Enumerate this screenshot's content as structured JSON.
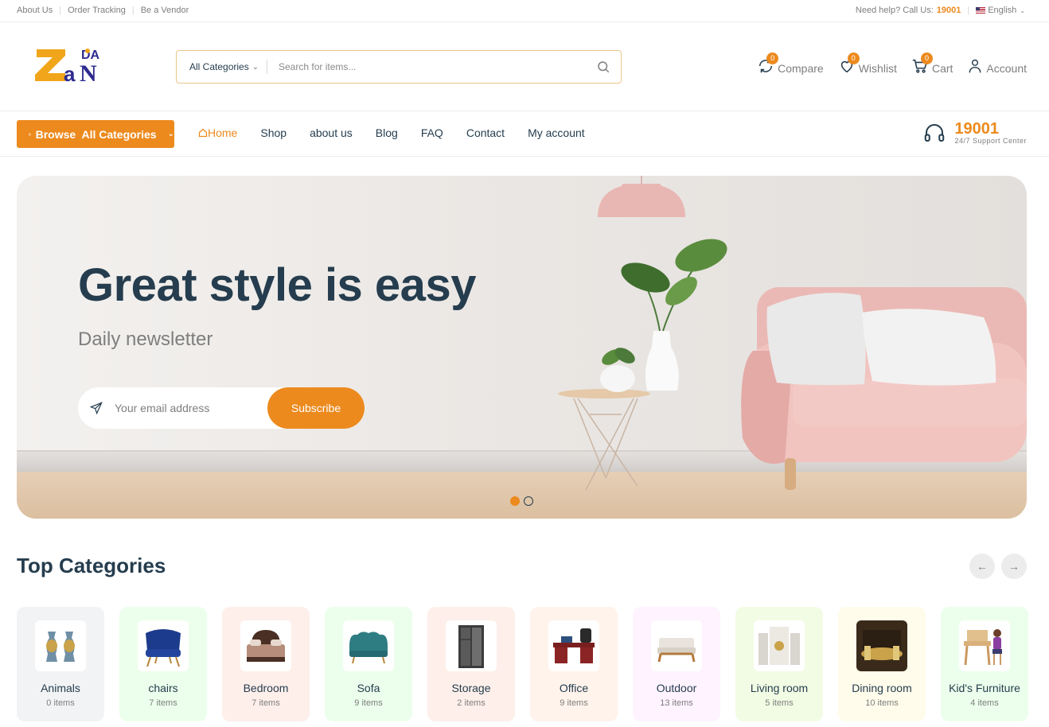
{
  "topbar": {
    "links": [
      "About Us",
      "Order Tracking",
      "Be a Vendor"
    ],
    "help_text": "Need help? Call Us:",
    "help_phone": "19001",
    "language": "English"
  },
  "header": {
    "search_category": "All Categories",
    "search_placeholder": "Search for items...",
    "actions": [
      {
        "label": "Compare",
        "count": "0",
        "icon": "compare-icon"
      },
      {
        "label": "Wishlist",
        "count": "0",
        "icon": "heart-icon"
      },
      {
        "label": "Cart",
        "count": "0",
        "icon": "cart-icon"
      },
      {
        "label": "Account",
        "icon": "user-icon"
      }
    ]
  },
  "nav": {
    "browse_label": "Browse  All Categories",
    "items": [
      "Home",
      "Shop",
      "about us",
      "Blog",
      "FAQ",
      "Contact",
      "My account"
    ],
    "active": "Home",
    "support_number": "19001",
    "support_label": "24/7 Support Center"
  },
  "hero": {
    "title": "Great style is easy",
    "subtitle": "Daily newsletter",
    "email_placeholder": "Your email address",
    "subscribe_label": "Subscribe",
    "slides": 2,
    "active_slide": 1
  },
  "categories": {
    "title": "Top Categories",
    "items": [
      {
        "name": "Animals",
        "count": "0 items",
        "bg": "#f2f3f4"
      },
      {
        "name": "chairs",
        "count": "7 items",
        "bg": "#ecffec"
      },
      {
        "name": "Bedroom",
        "count": "7 items",
        "bg": "#feefea"
      },
      {
        "name": "Sofa",
        "count": "9 items",
        "bg": "#ecffec"
      },
      {
        "name": "Storage",
        "count": "2 items",
        "bg": "#feefea"
      },
      {
        "name": "Office",
        "count": "9 items",
        "bg": "#fff3eb"
      },
      {
        "name": "Outdoor",
        "count": "13 items",
        "bg": "#fff3ff"
      },
      {
        "name": "Living room",
        "count": "5 items",
        "bg": "#f2fce4"
      },
      {
        "name": "Dining room",
        "count": "10 items",
        "bg": "#fffceb"
      },
      {
        "name": "Kid's Furniture",
        "count": "4 items",
        "bg": "#ecffec"
      }
    ]
  },
  "colors": {
    "accent": "#ec8a1e",
    "heading": "#253d4e",
    "muted": "#7e7e7e"
  }
}
